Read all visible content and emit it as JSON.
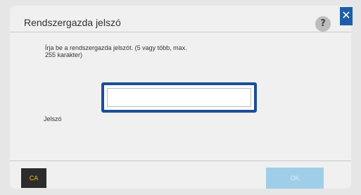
{
  "dialog": {
    "title": "Rendszergazda jelszó",
    "help_label": "?",
    "close_label": "✕",
    "instruction_line1": "Írja be a rendszergazda jelszót. (5 vagy több, max.",
    "instruction_line2": "255 karakter)",
    "password_label": "Jelszó",
    "password_value": "",
    "password_placeholder": "",
    "ca_label": "CA",
    "ok_label": "OK"
  },
  "colors": {
    "accent_blue": "#1d4e97",
    "close_blue": "#1d5ea8",
    "ok_disabled": "#9fcfe8",
    "ca_text": "#f0c000"
  },
  "icons": {
    "help": "question-mark-icon",
    "close": "close-icon"
  }
}
